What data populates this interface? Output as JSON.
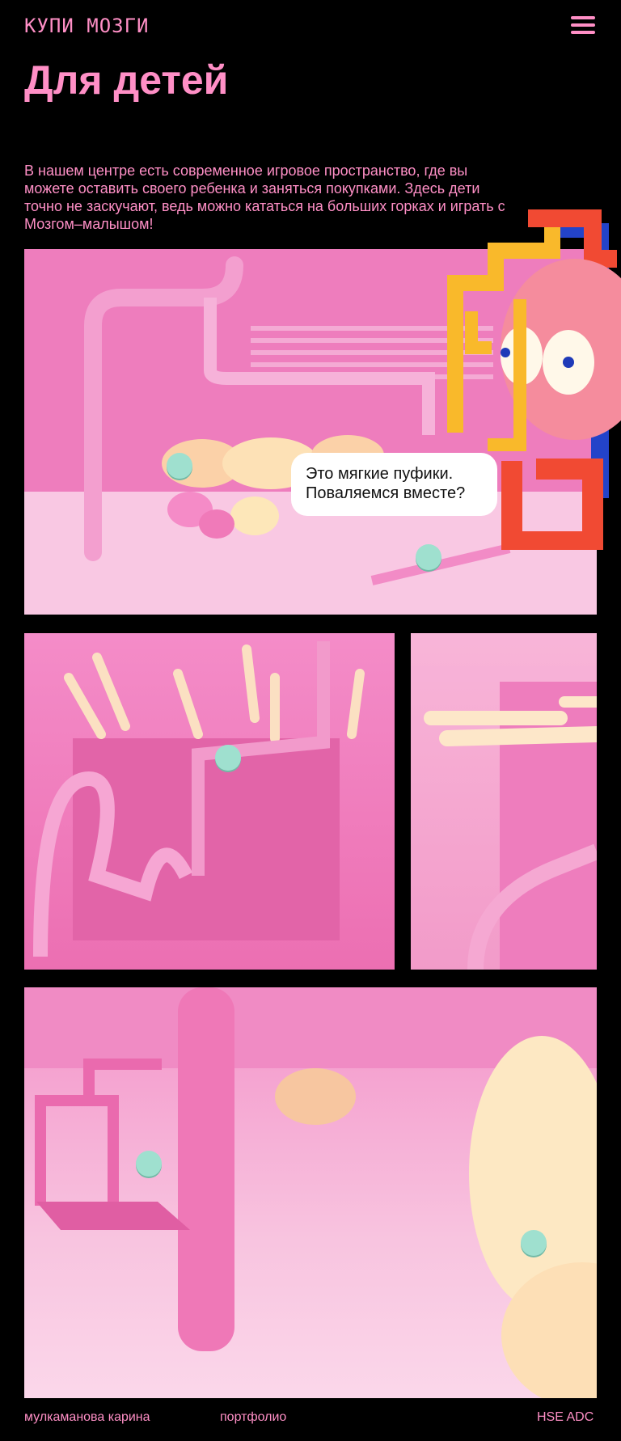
{
  "header": {
    "logo": "КУПИ МОЗГИ",
    "menu_icon": "hamburger-menu-icon"
  },
  "page": {
    "title": "Для детей",
    "intro": "В нашем центре есть современное игровое пространство, где вы можете оставить своего ребенка и заняться покупками. Здесь дети точно не заскучают, ведь можно кататься на больших горках и играть с Мозгом–малышом!"
  },
  "bubble": {
    "line1": "Это мягкие пуфики.",
    "line2": "Поваляемся вместе?"
  },
  "footer": {
    "author": "мулкаманова карина",
    "portfolio": "портфолио",
    "org": "HSE ADC"
  },
  "colors": {
    "accent": "#ff8fc6",
    "background": "#000000",
    "hotspot": "#9fe0cf"
  }
}
